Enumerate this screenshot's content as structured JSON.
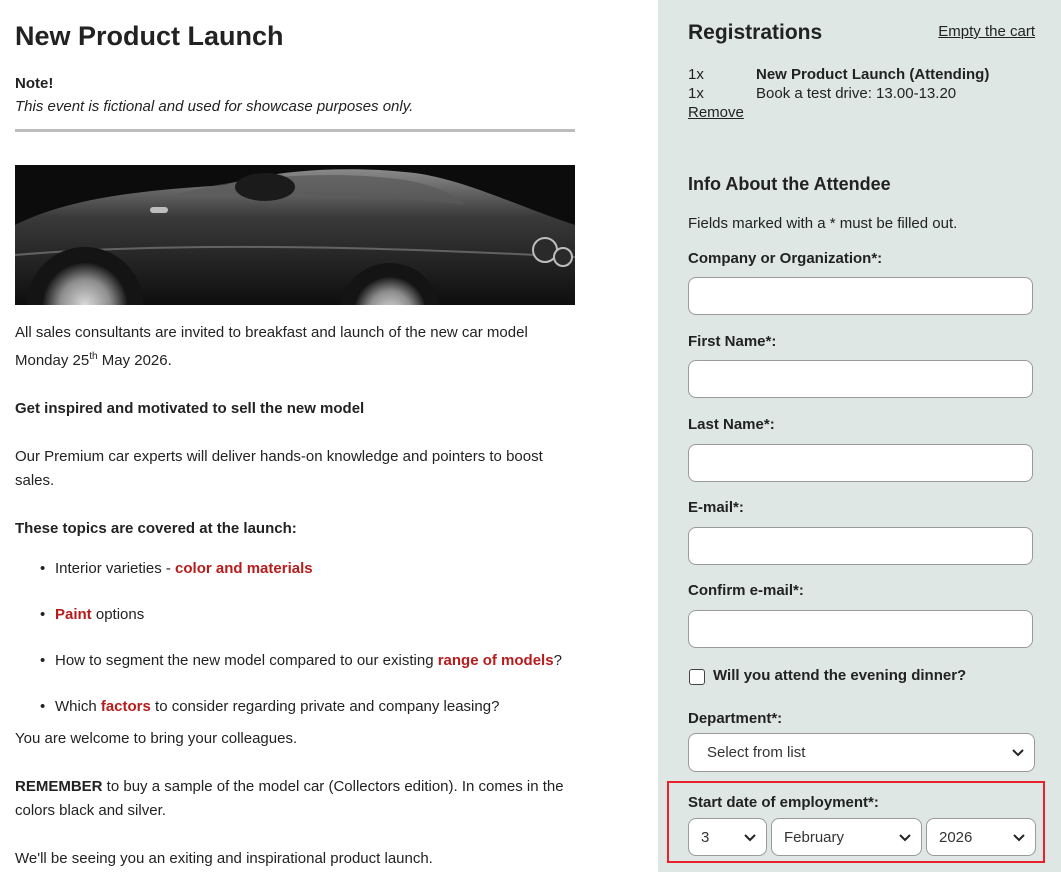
{
  "event": {
    "title": "New Product Launch",
    "note_heading": "Note!",
    "note_text": "This event is fictional and used for showcase purposes only.",
    "hero_alt": "Car image",
    "intro_line": "All sales consultants are invited to breakfast and launch of the new car model",
    "date_prefix": "Monday 25",
    "date_sup": "th",
    "date_suffix": " May 2026.",
    "bold_heading": "Get inspired and motivated to sell the new model",
    "experts_text": "Our Premium car experts will deliver hands-on knowledge and pointers to boost sales.",
    "topics_heading": "These topics are covered at the launch:",
    "topics": [
      {
        "before": "Interior varieties - ",
        "link": "color and materials",
        "after": ""
      },
      {
        "before": "",
        "link": "Paint",
        "after": " options"
      },
      {
        "before": "How to segment the new model compared to our existing ",
        "link": "range of models",
        "after": "?"
      },
      {
        "before": "Which ",
        "link": "factors",
        "after": " to consider regarding private and company leasing?"
      }
    ],
    "welcome_text": "You are welcome to bring your colleagues.",
    "remember_bold": "REMEMBER",
    "remember_text": " to buy a sample of the model car (Collectors edition). In comes in the colors black and silver.",
    "closing_text": "We'll be seeing you an exiting and inspirational product launch."
  },
  "cart": {
    "title": "Registrations",
    "empty_label": "Empty the cart",
    "items": [
      {
        "qty": "1x",
        "name": "New Product Launch (Attending)"
      },
      {
        "qty": "1x",
        "name": "Book a test drive: 13.00-13.20"
      }
    ],
    "remove_label": "Remove"
  },
  "form": {
    "title": "Info About the Attendee",
    "required_note": "Fields marked with a * must be filled out.",
    "company_label": "Company or Organization*:",
    "company_value": "",
    "first_name_label": "First Name*:",
    "first_name_value": "",
    "last_name_label": "Last Name*:",
    "last_name_value": "",
    "email_label": "E-mail*:",
    "email_value": "",
    "confirm_email_label": "Confirm e-mail*:",
    "confirm_email_value": "",
    "dinner_label": "Will you attend the evening dinner?",
    "dinner_checked": false,
    "department_label": "Department*:",
    "department_value": "Select from list",
    "start_date_label": "Start date of employment*:",
    "start_day": "3",
    "start_month": "February",
    "start_year": "2026"
  },
  "colors": {
    "sidebar_bg": "#dfe7e5",
    "link_red": "#b71c1c",
    "highlight_red": "#e8212b"
  }
}
